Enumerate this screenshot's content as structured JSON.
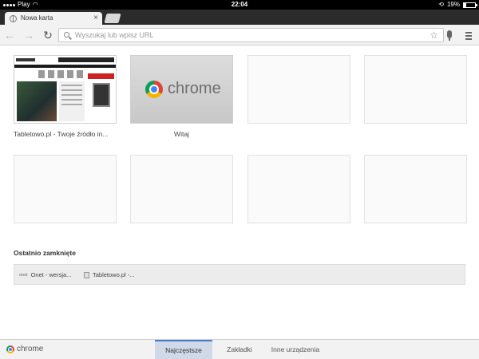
{
  "status_bar": {
    "carrier": "Play",
    "time": "22:04",
    "battery": "19%",
    "battery_level": 0.19
  },
  "tab": {
    "title": "Nowa karta",
    "close": "×"
  },
  "omnibox": {
    "placeholder": "Wyszukaj lub wpisz URL"
  },
  "most_visited": [
    {
      "label": "Tabletowo.pl - Twoje źródło in..."
    },
    {
      "label": "Witaj",
      "thumb_text": "chrome"
    }
  ],
  "recently_closed": {
    "title": "Ostatnio zamknięte",
    "items": [
      {
        "icon_label": "onet",
        "label": "Onet - wersja..."
      },
      {
        "label": "Tabletowo.pl -..."
      }
    ]
  },
  "bottom": {
    "brand": "chrome",
    "tabs": [
      {
        "label": "Najczęstsze",
        "active": true
      },
      {
        "label": "Zakładki",
        "active": false
      },
      {
        "label": "Inne urządzenia",
        "active": false
      }
    ]
  }
}
